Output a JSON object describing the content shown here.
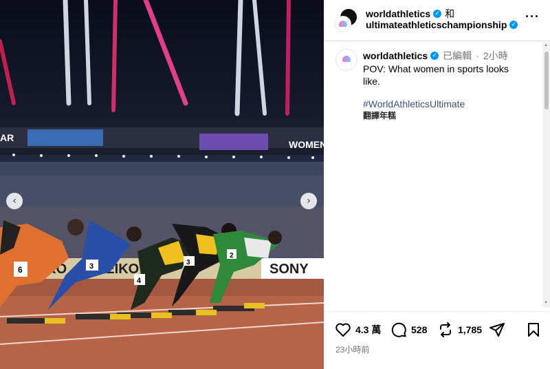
{
  "post": {
    "header": {
      "user1": "worldathletics",
      "and": "和",
      "user2": "ultimateathleticschampionship"
    },
    "caption": {
      "username": "worldathletics",
      "edited": "已編輯",
      "age": "2小時",
      "text": "POV: What women in sports looks like.",
      "hashtag": "#WorldAthleticsUltimate",
      "translate": "翻譯年糕"
    },
    "stats": {
      "likes": "4.3 萬",
      "comments": "528",
      "reposts": "1,785"
    },
    "timestamp": "23小時前"
  },
  "photo": {
    "signs": [
      "AR",
      "WOMEN",
      "SEIKO",
      "SEIKO",
      "SONY"
    ],
    "bibs": [
      "6",
      "3",
      "4",
      "3",
      "2"
    ]
  },
  "icons": {
    "prev": "chevron-left-icon",
    "next": "chevron-right-icon",
    "more": "more-horizontal-icon",
    "like": "heart-icon",
    "comment": "comment-icon",
    "repost": "repost-icon",
    "share": "send-icon",
    "save": "bookmark-icon"
  },
  "colors": {
    "verified": "#0095f6",
    "hashtag": "#385185"
  }
}
